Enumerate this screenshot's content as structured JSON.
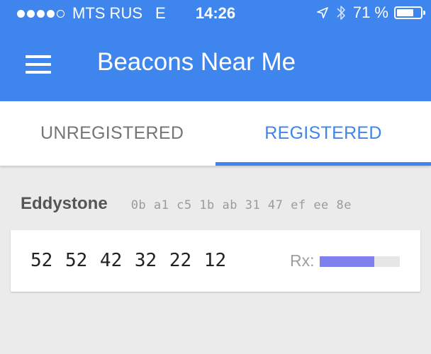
{
  "status_bar": {
    "signal_dots_filled": 4,
    "signal_dots_total": 5,
    "carrier": "MTS RUS",
    "network": "E",
    "time": "14:26",
    "location_icon": "location-arrow-icon",
    "bluetooth_icon": "bluetooth-icon",
    "battery_percent_label": "71 %",
    "battery_level": 0.71
  },
  "app_bar": {
    "menu_icon": "hamburger-menu-icon",
    "title": "Beacons Near Me",
    "color": "#3e86ee"
  },
  "tabs": [
    {
      "label": "UNREGISTERED",
      "selected": false
    },
    {
      "label": "REGISTERED",
      "selected": true
    }
  ],
  "section": {
    "title": "Eddystone",
    "namespace_id": "0b a1 c5 1b ab 31 47 ef ee 8e"
  },
  "beacons": [
    {
      "instance_id": "52 52 42 32 22 12",
      "rx_label": "Rx:",
      "rx_level": 0.68,
      "rx_color": "#7f7ff0"
    }
  ]
}
